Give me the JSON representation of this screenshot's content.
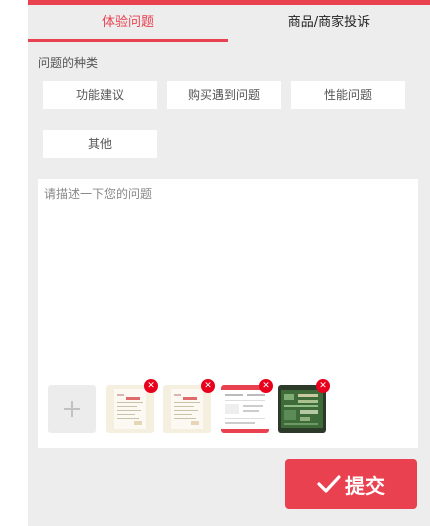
{
  "tabs": [
    {
      "label": "体验问题",
      "active": true
    },
    {
      "label": "商品/商家投诉",
      "active": false
    }
  ],
  "category": {
    "label": "问题的种类",
    "options": [
      "功能建议",
      "购买遇到问题",
      "性能问题",
      "其他"
    ]
  },
  "description": {
    "placeholder": "请描述一下您的问题",
    "value": ""
  },
  "attachments": {
    "add_icon": "plus-icon",
    "delete_icon": "close-icon",
    "delete_glyph": "✕",
    "thumbnail_count": 4
  },
  "submit": {
    "label": "提交",
    "icon": "checkmark-icon"
  },
  "colors": {
    "accent": "#e9414f",
    "background": "#ededed",
    "delete_badge": "#e8001c"
  }
}
